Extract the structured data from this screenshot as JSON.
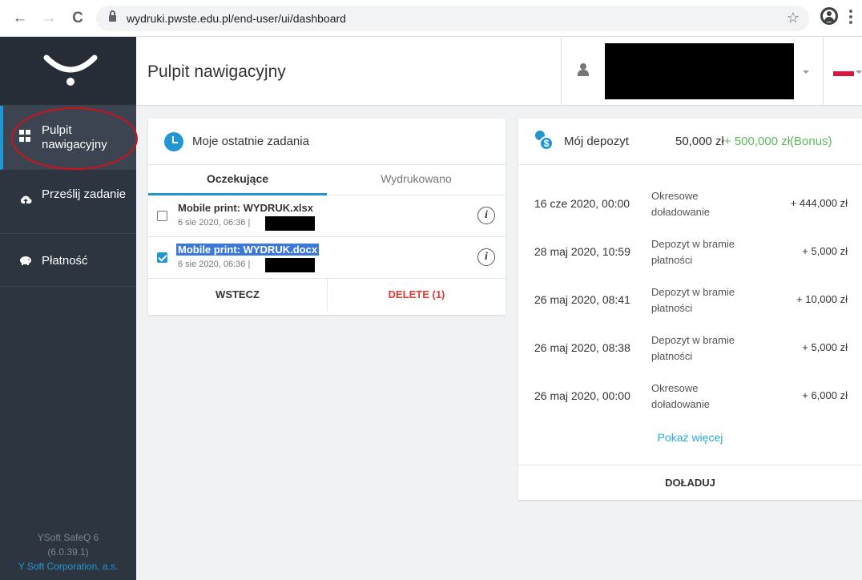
{
  "browser": {
    "url": "wydruki.pwste.edu.pl/end-user/ui/dashboard",
    "back_icon": "←",
    "forward_icon": "→",
    "reload_icon": "C",
    "star_icon": "☆"
  },
  "sidebar": {
    "items": [
      {
        "label": "Pulpit nawigacyjny",
        "icon": "dashboard-grid-icon"
      },
      {
        "label": "Prześlij zadanie",
        "icon": "upload-icon"
      },
      {
        "label": "Płatność",
        "icon": "piggy-bank-icon"
      }
    ],
    "footer": {
      "product": "YSoft SafeQ 6",
      "version": "(6.0.39.1)",
      "company": "Y Soft Corporation, a.s."
    }
  },
  "header": {
    "title": "Pulpit nawigacyjny"
  },
  "jobs_card": {
    "title": "Moje ostatnie zadania",
    "tabs": [
      "Oczekujące",
      "Wydrukowano"
    ],
    "jobs": [
      {
        "name": "Mobile print: WYDRUK.xlsx",
        "meta": "6 sie 2020, 06:36 |",
        "checked": false
      },
      {
        "name": "Mobile print: WYDRUK.docx",
        "meta": "6 sie 2020, 06:36 |",
        "checked": true
      }
    ],
    "back_label": "WSTECZ",
    "delete_label": "DELETE (1)"
  },
  "deposit_card": {
    "title": "Mój depozyt",
    "amount": "50,000 zł",
    "bonus": "+ 500,000 zł(Bonus)",
    "transactions": [
      {
        "date": "16 cze 2020, 00:00",
        "desc": "Okresowe doładowanie",
        "amount": "+ 444,000 zł"
      },
      {
        "date": "28 maj 2020, 10:59",
        "desc": "Depozyt w bramie płatności",
        "amount": "+ 5,000 zł"
      },
      {
        "date": "26 maj 2020, 08:41",
        "desc": "Depozyt w bramie płatności",
        "amount": "+ 10,000 zł"
      },
      {
        "date": "26 maj 2020, 08:38",
        "desc": "Depozyt w bramie płatności",
        "amount": "+ 5,000 zł"
      },
      {
        "date": "26 maj 2020, 00:00",
        "desc": "Okresowe doładowanie",
        "amount": "+ 6,000 zł"
      }
    ],
    "show_more": "Pokaż więcej",
    "topup_label": "DOŁADUJ"
  },
  "colors": {
    "accent": "#2196d3",
    "sidebar": "#2d3540",
    "delete": "#e53935",
    "bonus": "#5cb85c",
    "highlight_ring": "#d0111c"
  }
}
